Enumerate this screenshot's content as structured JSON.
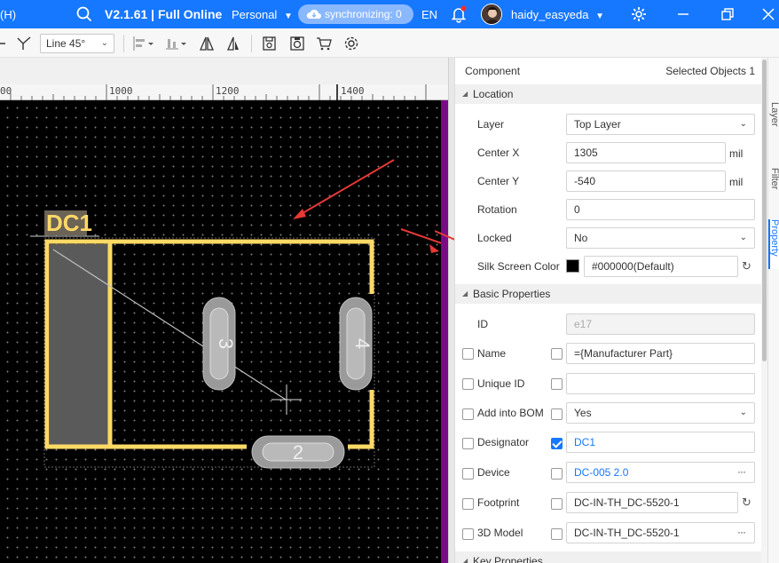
{
  "topbar": {
    "menu_partial": "(H)",
    "version": "V2.1.61 | Full Online",
    "workspace": "Personal",
    "sync_status": "synchronizing: 0",
    "language": "EN",
    "username": "haidy_easyeda",
    "accent_color": "#1677ff"
  },
  "toolbar": {
    "line_mode": "Line 45°"
  },
  "ruler": {
    "labels": [
      "00",
      "1000",
      "1200",
      "1400"
    ]
  },
  "canvas": {
    "designator_label": "DC1",
    "pad_labels": [
      "3",
      "4",
      "2"
    ],
    "silkscreen_color": "#ffd966",
    "background": "#000000"
  },
  "panel": {
    "title": "Component",
    "selected_label": "Selected Objects",
    "selected_count": "1",
    "location_section": "Location",
    "layer_label": "Layer",
    "layer_value": "Top Layer",
    "center_x_label": "Center X",
    "center_x_value": "1305",
    "center_y_label": "Center Y",
    "center_y_value": "-540",
    "unit": "mil",
    "rotation_label": "Rotation",
    "rotation_value": "0",
    "locked_label": "Locked",
    "locked_value": "No",
    "silk_color_label": "Silk Screen Color",
    "silk_color_value": "#000000(Default)",
    "basic_section": "Basic Properties",
    "id_label": "ID",
    "id_value": "e17",
    "name_label": "Name",
    "name_value": "={Manufacturer Part}",
    "unique_id_label": "Unique ID",
    "unique_id_value": "",
    "bom_label": "Add into BOM",
    "bom_value": "Yes",
    "designator_label": "Designator",
    "designator_value": "DC1",
    "device_label": "Device",
    "device_value": "DC-005 2.0",
    "footprint_label": "Footprint",
    "footprint_value": "DC-IN-TH_DC-5520-1",
    "model3d_label": "3D Model",
    "model3d_value": "DC-IN-TH_DC-5520-1",
    "key_section": "Key Properties"
  },
  "sidetabs": [
    "Layer",
    "Filter",
    "Property"
  ]
}
